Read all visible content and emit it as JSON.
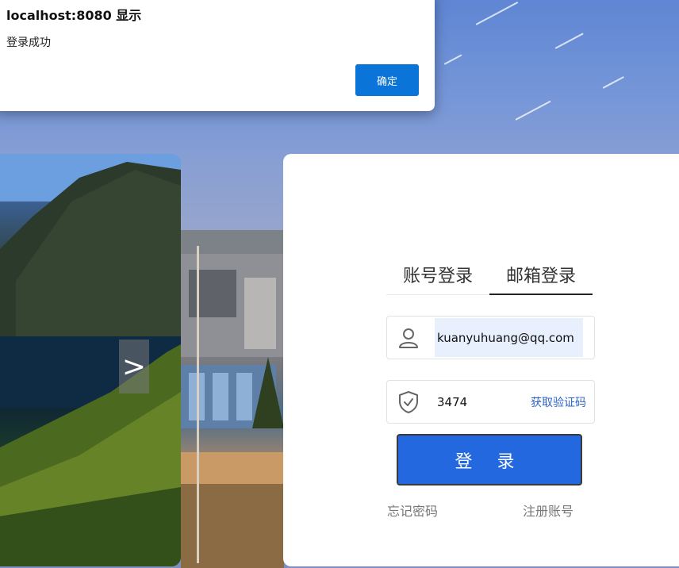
{
  "dialog": {
    "title": "localhost:8080 显示",
    "message": "登录成功",
    "ok_label": "确定"
  },
  "carousel": {
    "next_arrow": ">"
  },
  "login": {
    "tabs": [
      {
        "label": "账号登录",
        "active": false
      },
      {
        "label": "邮箱登录",
        "active": true
      }
    ],
    "email_value": "kuanyuhuang@qq.com",
    "code_value": "3474",
    "get_code_label": "获取验证码",
    "submit_label": "登 录",
    "forgot_label": "忘记密码",
    "register_label": "注册账号"
  },
  "icons": {
    "user": "user-icon",
    "shield": "shield-check-icon"
  },
  "colors": {
    "primary_button": "#2368de",
    "dialog_button": "#0a74d9",
    "link_blue": "#2d64c8"
  }
}
